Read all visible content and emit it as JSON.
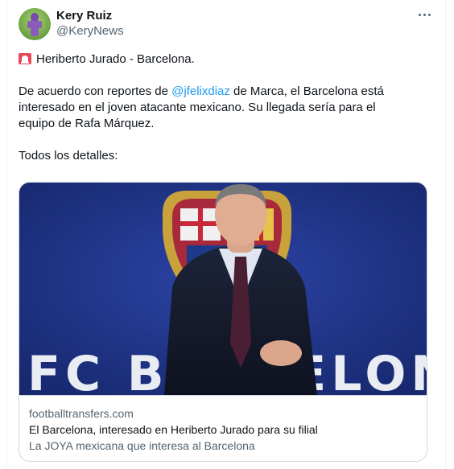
{
  "author": {
    "name": "Kery Ruiz",
    "handle": "@KeryNews"
  },
  "tweet": {
    "line1": "Heriberto Jurado - Barcelona.",
    "para1_before": "De acuerdo con reportes de ",
    "mention": "@jfelixdiaz",
    "para1_after": " de Marca, el Barcelona está",
    "para1_line2": "interesado en el joven atacante mexicano. Su llegada sería para el",
    "para1_line3": "equipo de Rafa Márquez.",
    "para2": "Todos los detalles:"
  },
  "link_card": {
    "image_text": "FC BARCELONA",
    "domain": "footballtransfers.com",
    "title": "El Barcelona, interesado en Heriberto Jurado para su filial",
    "description": "La JOYA mexicana que interesa al Barcelona"
  },
  "icons": {
    "more": "more-horizontal-icon",
    "siren": "rotating-light-icon"
  },
  "colors": {
    "mention": "#1d9bf0",
    "secondary_text": "#536471",
    "border": "#cfd9de"
  }
}
